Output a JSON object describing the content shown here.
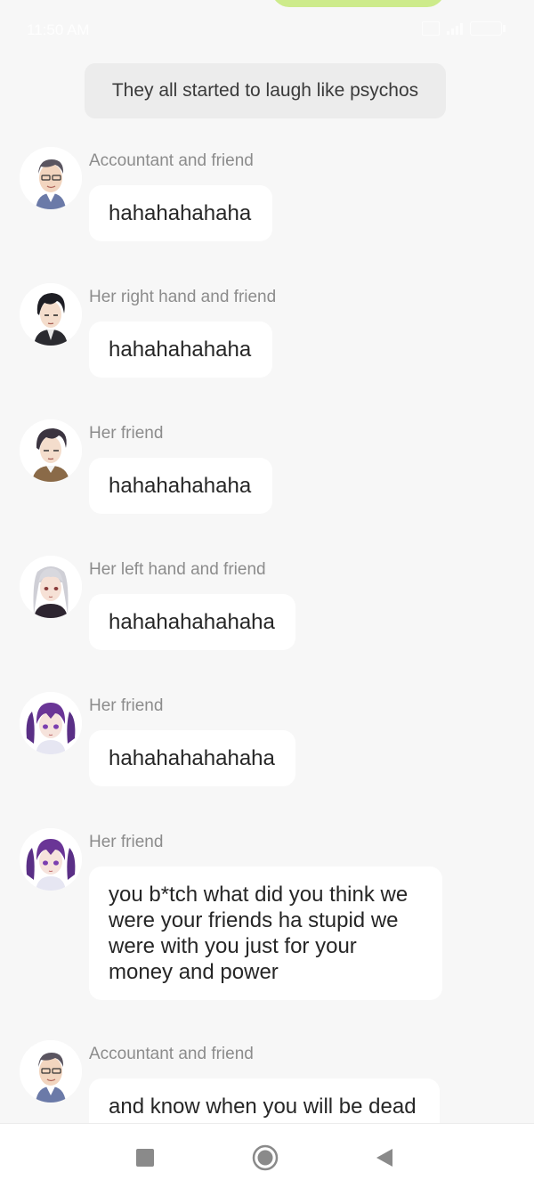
{
  "status": {
    "time": "11:50 AM",
    "icons": [
      "sim-icon",
      "signal-icon",
      "battery-icon"
    ]
  },
  "narration": "They all started to laugh like psychos",
  "messages": [
    {
      "sender": "Accountant and friend",
      "text": "hahahahahaha",
      "avatar": "accountant-avatar-icon"
    },
    {
      "sender": "Her right hand and friend",
      "text": "hahahahahaha",
      "avatar": "right-hand-avatar-icon"
    },
    {
      "sender": "Her friend",
      "text": "hahahahahaha",
      "avatar": "friend-avatar-icon"
    },
    {
      "sender": "Her left hand and friend",
      "text": "hahahahahahaha",
      "avatar": "left-hand-avatar-icon"
    },
    {
      "sender": "Her friend",
      "text": "hahahahahahaha",
      "avatar": "purple-hair-friend-avatar-icon"
    },
    {
      "sender": "Her friend",
      "text": "you b*tch what did you think we were your friends ha stupid we were with you just for your money and power",
      "avatar": "purple-hair-friend-avatar-icon"
    },
    {
      "sender": "Accountant and friend",
      "text": "and know when you will be dead",
      "avatar": "accountant-avatar-icon"
    }
  ],
  "navigation": {
    "buttons": [
      "recents-square-icon",
      "home-circle-icon",
      "back-triangle-icon"
    ]
  },
  "colors": {
    "background": "#f7f7f7",
    "bubble": "#ffffff",
    "narration_bg": "#ececec",
    "player_bubble": "#cdeb8b",
    "sender_text": "#8c8c8c"
  }
}
